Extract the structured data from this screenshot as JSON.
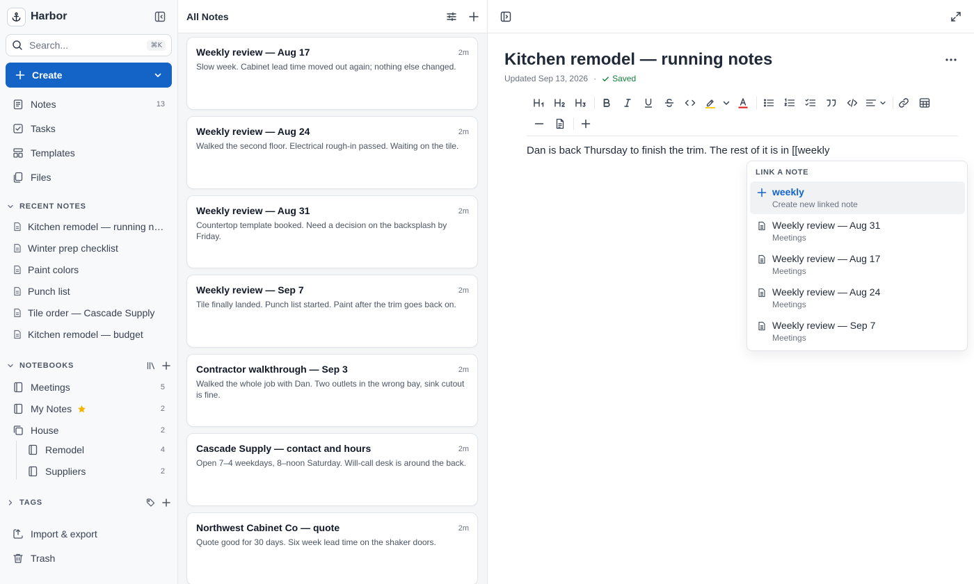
{
  "brand": {
    "name": "Harbor"
  },
  "search": {
    "placeholder": "Search...",
    "shortcut": "⌘K"
  },
  "create": {
    "label": "Create"
  },
  "nav": [
    {
      "label": "Notes",
      "count": "13",
      "icon": "notes-icon"
    },
    {
      "label": "Tasks",
      "icon": "check-square-icon"
    },
    {
      "label": "Templates",
      "icon": "templates-icon"
    },
    {
      "label": "Files",
      "icon": "files-icon"
    }
  ],
  "recent": {
    "heading": "RECENT NOTES",
    "items": [
      "Kitchen remodel — running notes",
      "Winter prep checklist",
      "Paint colors",
      "Punch list",
      "Tile order — Cascade Supply",
      "Kitchen remodel — budget"
    ]
  },
  "notebooks": {
    "heading": "NOTEBOOKS",
    "items": [
      {
        "label": "Meetings",
        "count": "5"
      },
      {
        "label": "My Notes",
        "count": "2",
        "starred": true
      },
      {
        "label": "House",
        "count": "2"
      },
      {
        "label": "Remodel",
        "count": "4"
      },
      {
        "label": "Suppliers",
        "count": "2"
      }
    ]
  },
  "tags": {
    "heading": "TAGS"
  },
  "footer": {
    "import_label": "Import & export",
    "trash_label": "Trash"
  },
  "list": {
    "title": "All Notes",
    "cards": [
      {
        "title": "Weekly review — Aug 17",
        "time": "2m",
        "snippet": "Slow week. Cabinet lead time moved out again; nothing else changed."
      },
      {
        "title": "Weekly review — Aug 24",
        "time": "2m",
        "snippet": "Walked the second floor. Electrical rough-in passed. Waiting on the tile."
      },
      {
        "title": "Weekly review — Aug 31",
        "time": "2m",
        "snippet": "Countertop template booked. Need a decision on the backsplash by Friday."
      },
      {
        "title": "Weekly review — Sep 7",
        "time": "2m",
        "snippet": "Tile finally landed. Punch list started. Paint after the trim goes back on."
      },
      {
        "title": "Contractor walkthrough — Sep 3",
        "time": "2m",
        "snippet": "Walked the whole job with Dan. Two outlets in the wrong bay, sink cutout is fine."
      },
      {
        "title": "Cascade Supply — contact and hours",
        "time": "2m",
        "snippet": "Open 7–4 weekdays, 8–noon Saturday. Will-call desk is around the back."
      },
      {
        "title": "Northwest Cabinet Co — quote",
        "time": "2m",
        "snippet": "Quote good for 30 days. Six week lead time on the shaker doors."
      }
    ]
  },
  "editor": {
    "title": "Kitchen remodel — running notes",
    "updated": "Updated Sep 13, 2026",
    "status": "Saved",
    "body": "Dan is back Thursday to finish the trim. The rest of it is in [[weekly",
    "colors": {
      "accent": "#1464c8",
      "saved": "#15803d",
      "highlight": "#facc15",
      "text_color": "#dc2626"
    }
  },
  "link_popup": {
    "heading": "LINK A NOTE",
    "items": [
      {
        "title": "weekly",
        "subtitle": "Create new linked note",
        "icon": "plus-icon",
        "active": true
      },
      {
        "title": "Weekly review — Aug 31",
        "subtitle": "Meetings",
        "icon": "document-icon"
      },
      {
        "title": "Weekly review — Aug 17",
        "subtitle": "Meetings",
        "icon": "document-icon"
      },
      {
        "title": "Weekly review — Aug 24",
        "subtitle": "Meetings",
        "icon": "document-icon"
      },
      {
        "title": "Weekly review — Sep 7",
        "subtitle": "Meetings",
        "icon": "document-icon"
      }
    ]
  }
}
